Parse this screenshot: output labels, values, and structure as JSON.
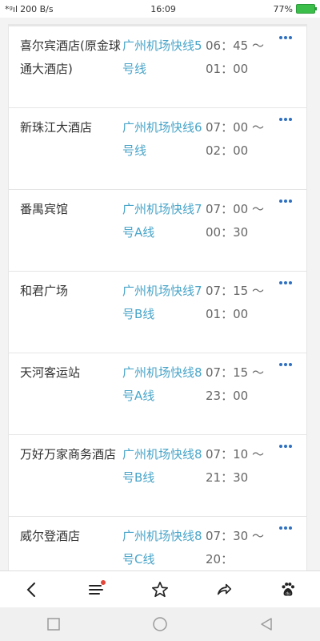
{
  "status": {
    "signal": "*ᵍıl",
    "speed": "200 B/s",
    "time": "16:09",
    "battery": "77%"
  },
  "rows": [
    {
      "name": "喜尔宾酒店(原金球通大酒店)",
      "route": "广州机场快线5号线",
      "time": "06：45 ～01：00"
    },
    {
      "name": "新珠江大酒店",
      "route": "广州机场快线6号线",
      "time": "07：00 ～02：00"
    },
    {
      "name": "番禺宾馆",
      "route": "广州机场快线7号A线",
      "time": "07：00 ～00：30"
    },
    {
      "name": "和君广场",
      "route": "广州机场快线7号B线",
      "time": "07：15 ～01：00"
    },
    {
      "name": "天河客运站",
      "route": "广州机场快线8号A线",
      "time": "07：15 ～23：00"
    },
    {
      "name": "万好万家商务酒店",
      "route": "广州机场快线8号B线",
      "time": "07：10 ～21：30"
    },
    {
      "name": "威尔登酒店",
      "route": "广州机场快线8号C线",
      "time": "07：30 ～20："
    }
  ],
  "icons": {
    "back": "back-icon",
    "menu": "menu-icon",
    "star": "star-icon",
    "share": "share-icon",
    "baidu": "baidu-paw-icon"
  },
  "colors": {
    "route": "#4aa5c9",
    "more": "#2f6fbf",
    "notification": "#e3463a"
  }
}
